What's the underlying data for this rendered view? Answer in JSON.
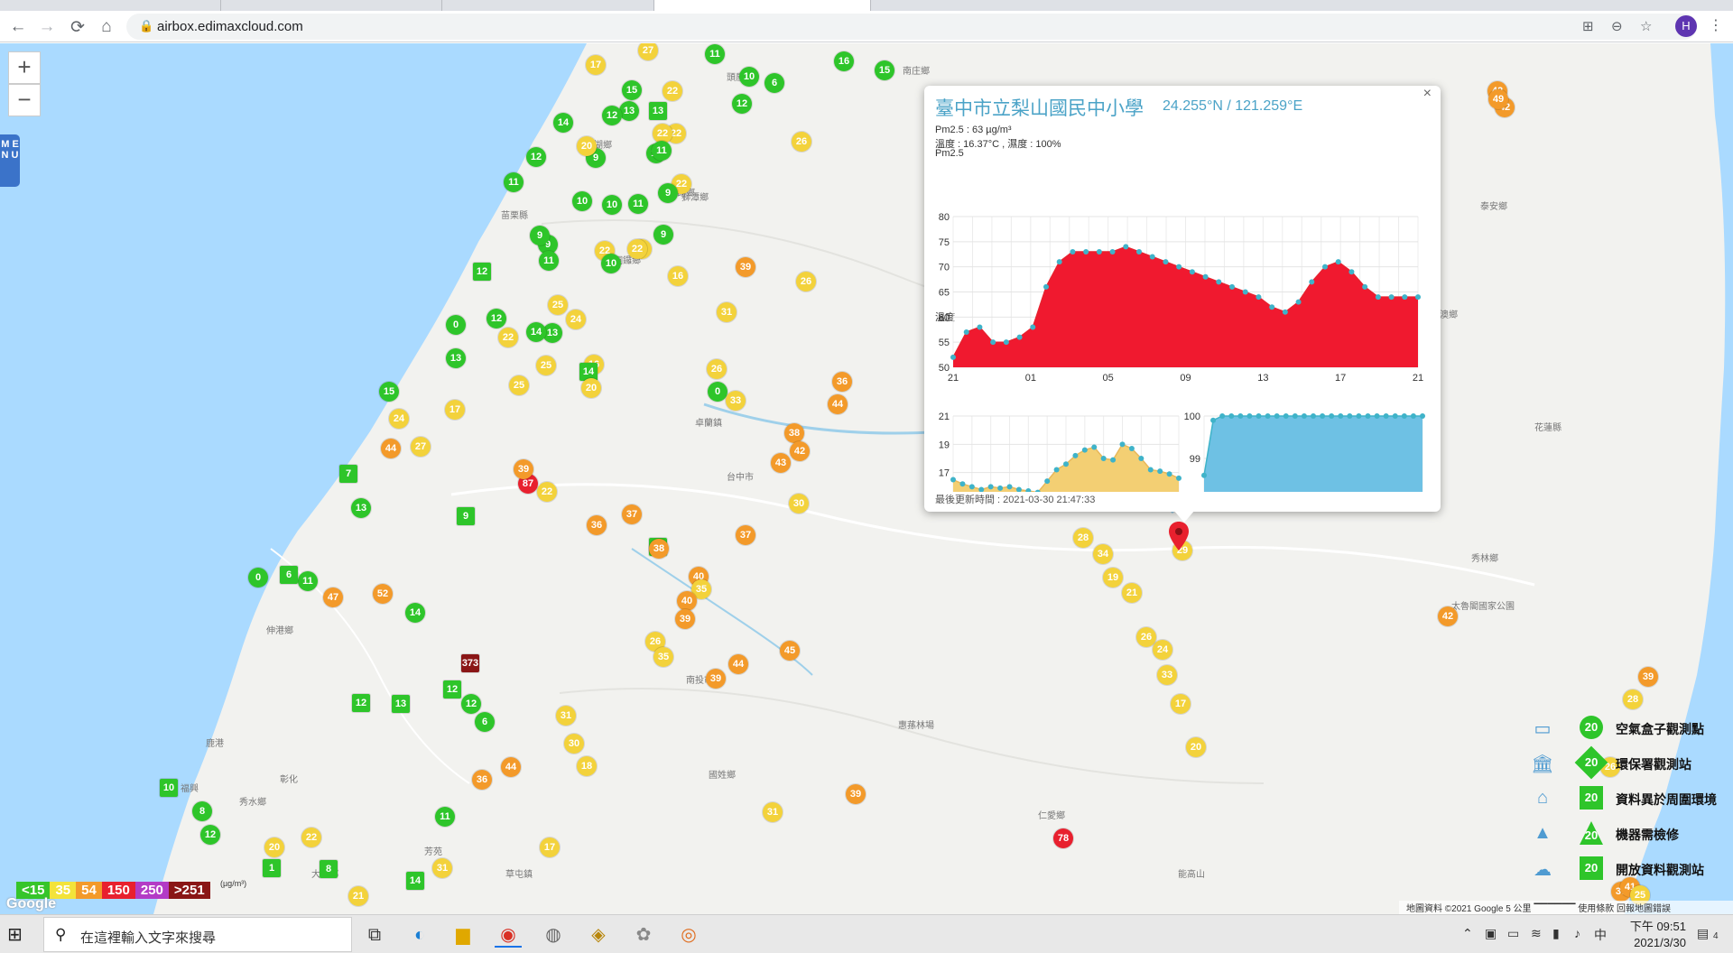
{
  "browser": {
    "url": "airbox.edimaxcloud.com",
    "avatar_letter": "H"
  },
  "map": {
    "labels": [
      {
        "t": "造橋鄉"
      },
      {
        "t": "三灣鄉"
      },
      {
        "t": "頭屋鄉"
      },
      {
        "t": "南庄鄉"
      },
      {
        "t": "西湖鄉"
      },
      {
        "t": "公館鄉"
      },
      {
        "t": "獅潭鄉"
      },
      {
        "t": "銅鑼鄉"
      },
      {
        "t": "大湖鄉"
      },
      {
        "t": "苗栗縣"
      },
      {
        "t": "卓蘭鎮"
      },
      {
        "t": "台中市"
      },
      {
        "t": "伸港鄉"
      },
      {
        "t": "鹿港"
      },
      {
        "t": "福興"
      },
      {
        "t": "彰化"
      },
      {
        "t": "秀水鄉"
      },
      {
        "t": "芳苑"
      },
      {
        "t": "大村鄉"
      },
      {
        "t": "草屯鎮"
      },
      {
        "t": "南投市"
      },
      {
        "t": "國姓鄉"
      },
      {
        "t": "惠蓀林場"
      },
      {
        "t": "仁愛鄉"
      },
      {
        "t": "能高山"
      },
      {
        "t": "秀林鄉"
      },
      {
        "t": "太魯閣國家公園"
      },
      {
        "t": "南澳鄉"
      },
      {
        "t": "花蓮縣"
      },
      {
        "t": "泰安鄉"
      }
    ],
    "markers": [
      {
        "v": "27",
        "c": "y"
      },
      {
        "v": "11",
        "c": "g"
      },
      {
        "v": "17",
        "c": "y"
      },
      {
        "v": "22",
        "c": "y"
      },
      {
        "v": "13",
        "c": "g"
      },
      {
        "v": "10",
        "c": "g"
      },
      {
        "v": "6",
        "c": "g"
      },
      {
        "v": "16",
        "c": "g"
      },
      {
        "v": "15",
        "c": "g"
      },
      {
        "v": "12",
        "c": "g"
      },
      {
        "v": "15",
        "c": "g"
      },
      {
        "v": "13",
        "c": "g",
        "sq": true
      },
      {
        "v": "22",
        "c": "y"
      },
      {
        "v": "14",
        "c": "g"
      },
      {
        "v": "9",
        "c": "g"
      },
      {
        "v": "26",
        "c": "y"
      },
      {
        "v": "12",
        "c": "g"
      },
      {
        "v": "22",
        "c": "y"
      },
      {
        "v": "11",
        "c": "g"
      },
      {
        "v": "12",
        "c": "g"
      },
      {
        "v": "20",
        "c": "y"
      },
      {
        "v": "11",
        "c": "g"
      },
      {
        "v": "22",
        "c": "y"
      },
      {
        "v": "11",
        "c": "g"
      },
      {
        "v": "10",
        "c": "g"
      },
      {
        "v": "10",
        "c": "g"
      },
      {
        "v": "11",
        "c": "g"
      },
      {
        "v": "9",
        "c": "g"
      },
      {
        "v": "9",
        "c": "g"
      },
      {
        "v": "19",
        "c": "y"
      },
      {
        "v": "9",
        "c": "g"
      },
      {
        "v": "9",
        "c": "g"
      },
      {
        "v": "12",
        "c": "g",
        "sq": true
      },
      {
        "v": "22",
        "c": "y"
      },
      {
        "v": "22",
        "c": "y"
      },
      {
        "v": "16",
        "c": "y"
      },
      {
        "v": "39",
        "c": "o"
      },
      {
        "v": "26",
        "c": "y"
      },
      {
        "v": "11",
        "c": "g"
      },
      {
        "v": "10",
        "c": "g"
      },
      {
        "v": "25",
        "c": "y"
      },
      {
        "v": "0",
        "c": "g"
      },
      {
        "v": "12",
        "c": "g"
      },
      {
        "v": "22",
        "c": "y"
      },
      {
        "v": "13",
        "c": "g"
      },
      {
        "v": "24",
        "c": "y"
      },
      {
        "v": "31",
        "c": "y"
      },
      {
        "v": "25",
        "c": "y"
      },
      {
        "v": "14",
        "c": "g"
      },
      {
        "v": "16",
        "c": "y"
      },
      {
        "v": "13",
        "c": "g"
      },
      {
        "v": "17",
        "c": "y"
      },
      {
        "v": "25",
        "c": "y"
      },
      {
        "v": "14",
        "c": "g",
        "sq": true
      },
      {
        "v": "20",
        "c": "y"
      },
      {
        "v": "26",
        "c": "y"
      },
      {
        "v": "0",
        "c": "g"
      },
      {
        "v": "33",
        "c": "y"
      },
      {
        "v": "15",
        "c": "g"
      },
      {
        "v": "24",
        "c": "y"
      },
      {
        "v": "44",
        "c": "o"
      },
      {
        "v": "27",
        "c": "y"
      },
      {
        "v": "36",
        "c": "o"
      },
      {
        "v": "44",
        "c": "o"
      },
      {
        "v": "38",
        "c": "o"
      },
      {
        "v": "42",
        "c": "o"
      },
      {
        "v": "43",
        "c": "o"
      },
      {
        "v": "87",
        "c": "r"
      },
      {
        "v": "39",
        "c": "o"
      },
      {
        "v": "22",
        "c": "y"
      },
      {
        "v": "7",
        "c": "g",
        "sq": true
      },
      {
        "v": "13",
        "c": "g"
      },
      {
        "v": "11",
        "c": "g"
      },
      {
        "v": "9",
        "c": "g",
        "sq": true
      },
      {
        "v": "36",
        "c": "o"
      },
      {
        "v": "37",
        "c": "o"
      },
      {
        "v": "30",
        "c": "y"
      },
      {
        "v": "37",
        "c": "o"
      },
      {
        "v": "10",
        "c": "g",
        "sq": true
      },
      {
        "v": "38",
        "c": "o"
      },
      {
        "v": "40",
        "c": "o"
      },
      {
        "v": "35",
        "c": "y"
      },
      {
        "v": "40",
        "c": "o"
      },
      {
        "v": "39",
        "c": "o"
      },
      {
        "v": "26",
        "c": "y"
      },
      {
        "v": "35",
        "c": "y"
      },
      {
        "v": "44",
        "c": "o"
      },
      {
        "v": "45",
        "c": "o"
      },
      {
        "v": "39",
        "c": "o"
      },
      {
        "v": "0",
        "c": "g"
      },
      {
        "v": "6",
        "c": "g",
        "sq": true
      },
      {
        "v": "47",
        "c": "o"
      },
      {
        "v": "52",
        "c": "o"
      },
      {
        "v": "14",
        "c": "g"
      },
      {
        "v": "373",
        "c": "m",
        "sq": true
      },
      {
        "v": "12",
        "c": "g",
        "sq": true
      },
      {
        "v": "13",
        "c": "g",
        "sq": true
      },
      {
        "v": "12",
        "c": "g"
      },
      {
        "v": "12",
        "c": "g",
        "sq": true
      },
      {
        "v": "6",
        "c": "g"
      },
      {
        "v": "44",
        "c": "o"
      },
      {
        "v": "36",
        "c": "o"
      },
      {
        "v": "30",
        "c": "y"
      },
      {
        "v": "18",
        "c": "y"
      },
      {
        "v": "10",
        "c": "g",
        "sq": true
      },
      {
        "v": "8",
        "c": "g"
      },
      {
        "v": "12",
        "c": "g"
      },
      {
        "v": "22",
        "c": "y"
      },
      {
        "v": "8",
        "c": "g",
        "sq": true
      },
      {
        "v": "20",
        "c": "y"
      },
      {
        "v": "1",
        "c": "g",
        "sq": true
      },
      {
        "v": "21",
        "c": "y"
      },
      {
        "v": "31",
        "c": "y"
      },
      {
        "v": "14",
        "c": "g",
        "sq": true
      },
      {
        "v": "11",
        "c": "g"
      },
      {
        "v": "31",
        "c": "y"
      },
      {
        "v": "17",
        "c": "y"
      },
      {
        "v": "39",
        "c": "o"
      },
      {
        "v": "31",
        "c": "y"
      },
      {
        "v": "78",
        "c": "r"
      },
      {
        "v": "42",
        "c": "o"
      },
      {
        "v": "42",
        "c": "o"
      },
      {
        "v": "39",
        "c": "o"
      },
      {
        "v": "28",
        "c": "y"
      },
      {
        "v": "26",
        "c": "y"
      },
      {
        "v": "37",
        "c": "o"
      },
      {
        "v": "41",
        "c": "o"
      },
      {
        "v": "25",
        "c": "y"
      },
      {
        "v": "42",
        "c": "o"
      },
      {
        "v": "49",
        "c": "o"
      },
      {
        "v": "24",
        "c": "y"
      },
      {
        "v": "15",
        "c": "y"
      },
      {
        "v": "21",
        "c": "y"
      },
      {
        "v": "15",
        "c": "g"
      },
      {
        "v": "25",
        "c": "y"
      },
      {
        "v": "38",
        "c": "o"
      },
      {
        "v": "24",
        "c": "y"
      },
      {
        "v": "29",
        "c": "y"
      },
      {
        "v": "33",
        "c": "y"
      },
      {
        "v": "22",
        "c": "y"
      },
      {
        "v": "25",
        "c": "y"
      },
      {
        "v": "27",
        "c": "y"
      },
      {
        "v": "30",
        "c": "y"
      },
      {
        "v": "23",
        "c": "y"
      },
      {
        "v": "32",
        "c": "y"
      },
      {
        "v": "18",
        "c": "y"
      },
      {
        "v": "28",
        "c": "y"
      },
      {
        "v": "34",
        "c": "y"
      },
      {
        "v": "19",
        "c": "y"
      },
      {
        "v": "21",
        "c": "y"
      },
      {
        "v": "26",
        "c": "y"
      },
      {
        "v": "24",
        "c": "y"
      },
      {
        "v": "33",
        "c": "y"
      },
      {
        "v": "17",
        "c": "y"
      },
      {
        "v": "20",
        "c": "y"
      },
      {
        "v": "29",
        "c": "y"
      },
      {
        "v": "31",
        "c": "y"
      },
      {
        "v": "27",
        "c": "y"
      },
      {
        "v": "23",
        "c": "y"
      },
      {
        "v": "16",
        "c": "y"
      },
      {
        "v": "83",
        "c": "r"
      }
    ]
  },
  "popup": {
    "title": "臺中市立梨山國民中小學",
    "coord": "24.255°N / 121.259°E",
    "pm_line": "Pm2.5 : 63 µg/m³",
    "th_line": "溫度 : 16.37°C , 濕度 : 100%",
    "pm_label": "Pm2.5",
    "temp_label": "溫度",
    "hum_label": "濕度",
    "updated": "最後更新時間 : 2021-03-30 21:47:33",
    "close": "×"
  },
  "chart_data": [
    {
      "type": "area",
      "title": "Pm2.5",
      "x_ticks": [
        "21",
        "01",
        "05",
        "09",
        "13",
        "17",
        "21"
      ],
      "ylim": [
        50,
        80
      ],
      "y_ticks": [
        50,
        55,
        60,
        65,
        70,
        75,
        80
      ],
      "color": "#f0192f",
      "values": [
        52,
        57,
        58,
        55,
        55,
        56,
        58,
        66,
        71,
        73,
        73,
        73,
        73,
        74,
        73,
        72,
        71,
        70,
        69,
        68,
        67,
        66,
        65,
        64,
        62,
        61,
        63,
        67,
        70,
        71,
        69,
        66,
        64,
        64,
        64,
        64
      ]
    },
    {
      "type": "area",
      "title": "溫度",
      "ylim": [
        15,
        21
      ],
      "y_ticks": [
        15,
        17,
        19,
        21
      ],
      "color": "#f3cf73",
      "values": [
        16.5,
        16.2,
        16.0,
        15.8,
        16.0,
        15.9,
        16.0,
        15.8,
        15.7,
        15.6,
        16.4,
        17.2,
        17.6,
        18.2,
        18.6,
        18.8,
        18.0,
        17.9,
        19.0,
        18.7,
        18.0,
        17.2,
        17.1,
        16.9,
        16.6
      ]
    },
    {
      "type": "area",
      "title": "濕度",
      "ylim": [
        98,
        100
      ],
      "y_ticks": [
        98,
        99,
        100
      ],
      "color": "#6ec1e4",
      "values": [
        98.6,
        99.9,
        100,
        100,
        100,
        100,
        100,
        100,
        100,
        100,
        100,
        100,
        100,
        100,
        100,
        100,
        100,
        100,
        100,
        100,
        100,
        100,
        100,
        100,
        100
      ]
    }
  ],
  "legend": [
    {
      "mark": "20",
      "label": "空氣盒子觀測點",
      "icon": "airbox-icon",
      "shape": "circle"
    },
    {
      "mark": "20",
      "label": "環保署觀測站",
      "icon": "epa-station-icon",
      "shape": "diamond"
    },
    {
      "mark": "20",
      "label": "資料異於周圍環境",
      "icon": "house-icon",
      "shape": "square"
    },
    {
      "mark": "20",
      "label": "機器需檢修",
      "icon": "cone-icon",
      "shape": "triangle"
    },
    {
      "mark": "20",
      "label": "開放資料觀測站",
      "icon": "open-data-icon",
      "shape": "square"
    }
  ],
  "scale": [
    {
      "t": "<15",
      "c": "#36c52a"
    },
    {
      "t": "35",
      "c": "#f3e33a"
    },
    {
      "t": "54",
      "c": "#f39a2a"
    },
    {
      "t": "150",
      "c": "#e8202e"
    },
    {
      "t": "250",
      "c": "#b33bc6"
    },
    {
      "t": ">251",
      "c": "#8a1616"
    }
  ],
  "scale_unit": "(µg/m³)",
  "google": "Google",
  "attribution": "地圖資料 ©2021 Google   5 公里 ▔▔▔▔▔▔   使用條款   回報地圖錯誤",
  "menu_text": "M E N U",
  "zoom": {
    "in": "+",
    "out": "−"
  },
  "taskbar": {
    "search": "在這裡輸入文字來搜尋",
    "time": "下午 09:51",
    "date": "2021/3/30",
    "ime": "中",
    "notif": "4"
  },
  "colors": {
    "g": "#2ec52a",
    "y": "#f3d23b",
    "o": "#f39a2a",
    "r": "#e8202e",
    "m": "#8a1616"
  }
}
